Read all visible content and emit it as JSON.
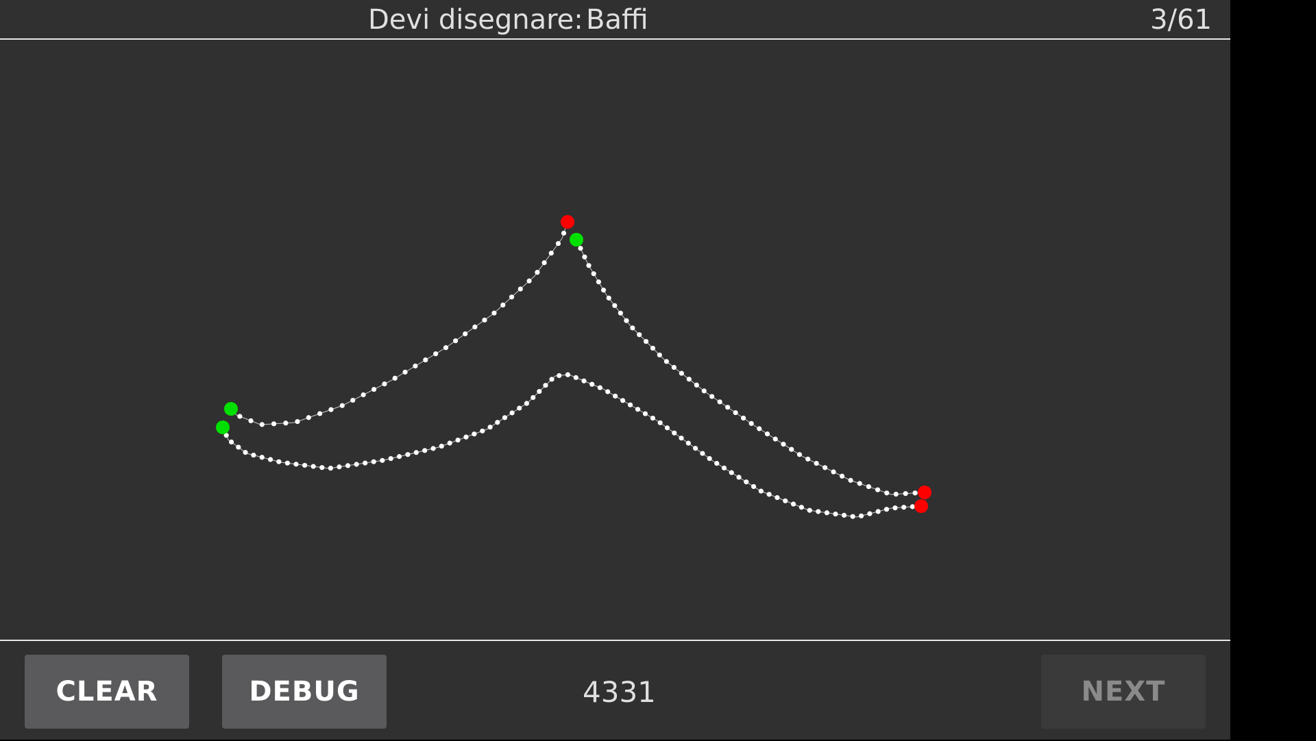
{
  "header": {
    "prompt_label": "Devi disegnare:",
    "prompt_word": "Baffi",
    "progress": "3/61"
  },
  "footer": {
    "clear_label": "CLEAR",
    "debug_label": "DEBUG",
    "score": "4331",
    "next_label": "NEXT",
    "next_enabled": false
  },
  "colors": {
    "background": "#303030",
    "stroke_point": "#ffffff",
    "start_point": "#00e000",
    "end_point": "#ff0000"
  }
}
